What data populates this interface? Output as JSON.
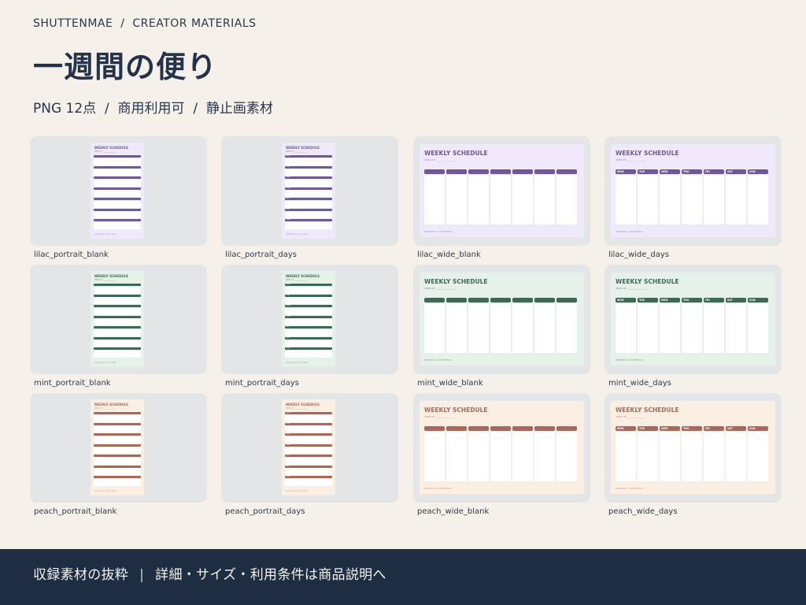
{
  "header": {
    "breadcrumb": "SHUTTENMAE  /  CREATOR MATERIALS",
    "title": "一週間の便り",
    "subtitle": "PNG 12点  /  商用利用可  /  静止画素材"
  },
  "sheet_text": {
    "title": "WEEKLY SCHEDULE",
    "week_of": "WEEK OF ________________",
    "footer": "PRESENTED / SHUTTENMAE"
  },
  "days": [
    "MON",
    "TUE",
    "WED",
    "THU",
    "FRI",
    "SAT",
    "SUN"
  ],
  "colors": {
    "lilac": {
      "bg": "#efe9fb",
      "accent": "#6f5a94"
    },
    "mint": {
      "bg": "#e6f1ea",
      "accent": "#3b6b58"
    },
    "peach": {
      "bg": "#fbeee2",
      "accent": "#a8685a"
    }
  },
  "cards": [
    {
      "label": "lilac_portrait_blank",
      "theme": "lilac",
      "layout": "portrait",
      "days": false
    },
    {
      "label": "lilac_portrait_days",
      "theme": "lilac",
      "layout": "portrait",
      "days": true
    },
    {
      "label": "lilac_wide_blank",
      "theme": "lilac",
      "layout": "wide",
      "days": false
    },
    {
      "label": "lilac_wide_days",
      "theme": "lilac",
      "layout": "wide",
      "days": true
    },
    {
      "label": "mint_portrait_blank",
      "theme": "mint",
      "layout": "portrait",
      "days": false
    },
    {
      "label": "mint_portrait_days",
      "theme": "mint",
      "layout": "portrait",
      "days": true
    },
    {
      "label": "mint_wide_blank",
      "theme": "mint",
      "layout": "wide",
      "days": false
    },
    {
      "label": "mint_wide_days",
      "theme": "mint",
      "layout": "wide",
      "days": true
    },
    {
      "label": "peach_portrait_blank",
      "theme": "peach",
      "layout": "portrait",
      "days": false
    },
    {
      "label": "peach_portrait_days",
      "theme": "peach",
      "layout": "portrait",
      "days": true
    },
    {
      "label": "peach_wide_blank",
      "theme": "peach",
      "layout": "wide",
      "days": false
    },
    {
      "label": "peach_wide_days",
      "theme": "peach",
      "layout": "wide",
      "days": true
    }
  ],
  "footer": {
    "left": "収録素材の抜粋",
    "separator": "|",
    "right": "詳細・サイズ・利用条件は商品説明へ"
  }
}
